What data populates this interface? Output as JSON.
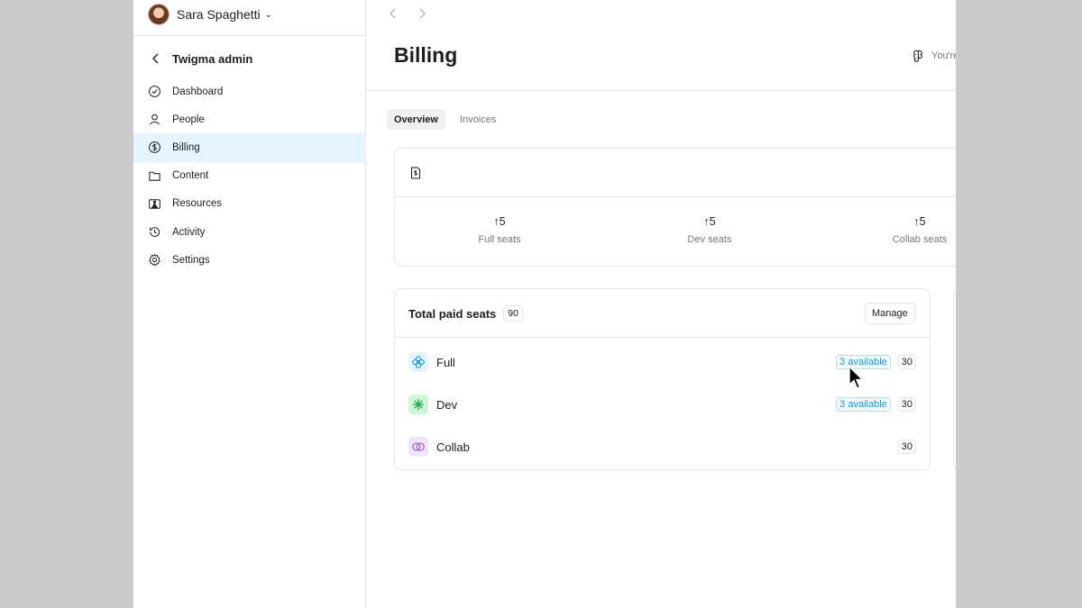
{
  "user": {
    "name": "Sara Spaghetti"
  },
  "sidebar": {
    "admin_title": "Twigma admin",
    "items": [
      {
        "label": "Dashboard",
        "icon": "dashboard-check-icon",
        "active": false
      },
      {
        "label": "People",
        "icon": "person-icon",
        "active": false
      },
      {
        "label": "Billing",
        "icon": "billing-dollar-icon",
        "active": true
      },
      {
        "label": "Content",
        "icon": "folder-icon",
        "active": false
      },
      {
        "label": "Resources",
        "icon": "resources-icon",
        "active": false
      },
      {
        "label": "Activity",
        "icon": "history-icon",
        "active": false
      },
      {
        "label": "Settings",
        "icon": "gear-icon",
        "active": false
      }
    ]
  },
  "header": {
    "title": "Billing",
    "status_text": "You're"
  },
  "tabs": [
    {
      "label": "Overview",
      "active": true
    },
    {
      "label": "Invoices",
      "active": false
    }
  ],
  "upcoming": {
    "stats": [
      {
        "value": "↑5",
        "label": "Full seats"
      },
      {
        "value": "↑5",
        "label": "Dev seats"
      },
      {
        "value": "↑5",
        "label": "Collab seats"
      }
    ]
  },
  "seats": {
    "title": "Total paid seats",
    "total": "90",
    "manage_label": "Manage",
    "rows": [
      {
        "name": "Full",
        "available": "3 available",
        "count": "30",
        "icon": "full-seat-icon",
        "icon_color": "#0d99ff",
        "icon_bg": "#e5f4ff"
      },
      {
        "name": "Dev",
        "available": "3 available",
        "count": "30",
        "icon": "dev-seat-icon",
        "icon_color": "#14ae5c",
        "icon_bg": "#cff7d3"
      },
      {
        "name": "Collab",
        "available": "",
        "count": "30",
        "icon": "collab-seat-icon",
        "icon_color": "#9747ff",
        "icon_bg": "#f1e5ff"
      }
    ]
  },
  "colors": {
    "accent": "#0d99ff",
    "active_nav_bg": "#e5f4ff"
  }
}
